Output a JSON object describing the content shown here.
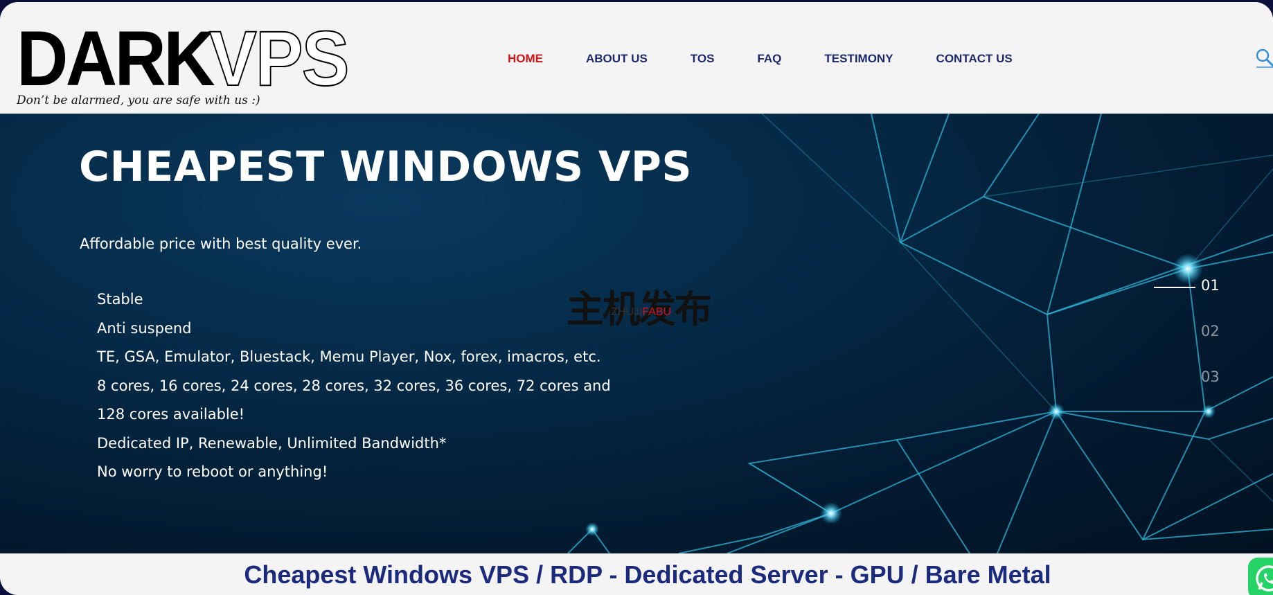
{
  "logo": {
    "part1": "DARK",
    "part2": "VPS",
    "tagline": "Don’t be alarmed, you are safe with us :)"
  },
  "nav": {
    "items": [
      {
        "label": "HOME",
        "active": true
      },
      {
        "label": "ABOUT US",
        "active": false
      },
      {
        "label": "TOS",
        "active": false
      },
      {
        "label": "FAQ",
        "active": false
      },
      {
        "label": "TESTIMONY",
        "active": false
      },
      {
        "label": "CONTACT US",
        "active": false
      }
    ],
    "search_icon": "search-icon"
  },
  "hero": {
    "title": "CHEAPEST WINDOWS VPS",
    "subtitle": "Affordable price with best quality ever.",
    "features": [
      "Stable",
      "Anti suspend",
      "TE, GSA, Emulator, Bluestack, Memu Player, Nox, forex, imacros, etc.",
      "8 cores, 16 cores, 24 cores, 28 cores, 32 cores, 36 cores, 72 cores and 128 cores available!",
      "Dedicated IP, Renewable, Unlimited Bandwidth*",
      "No worry to reboot or anything!"
    ],
    "slides": [
      "01",
      "02",
      "03"
    ],
    "active_slide": 0
  },
  "watermark": {
    "cn": "主机发布",
    "en_part1": "ZHUJI",
    "en_part2": "FABU"
  },
  "band": {
    "text": "Cheapest Windows VPS / RDP - Dedicated Server - GPU / Bare Metal"
  },
  "colors": {
    "nav_text": "#1c2a6b",
    "nav_active": "#d0141a",
    "band_text": "#1c2a7d",
    "hero_bg": "#031a30",
    "whatsapp": "#25d366"
  },
  "floating": {
    "whatsapp_icon": "whatsapp-icon"
  }
}
